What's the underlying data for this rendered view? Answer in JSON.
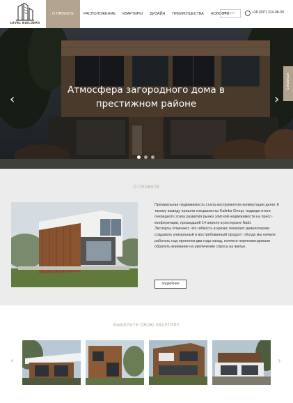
{
  "header": {
    "logo_text": "LEVEL BUILDERS",
    "nav": [
      {
        "label": "О ПРОЕКТЕ",
        "active": true
      },
      {
        "label": "РАСПОЛОЖЕНИЕ"
      },
      {
        "label": "КВАРТИРЫ"
      },
      {
        "label": "ДИЗАЙН"
      },
      {
        "label": "ПРЕИМУЩЕСТВА"
      },
      {
        "label": "НОВОСТИ"
      }
    ],
    "lang_current": "en",
    "lang_alt": "| рус",
    "phone": "+38 (097) 324-98-09"
  },
  "hero": {
    "title": "Атмосфера загородного дома в престижном районе",
    "slides_count": 3,
    "active_slide": 1,
    "side_tab_label": "Связаться"
  },
  "about": {
    "title": "О ПРОЕКТЕ",
    "paragraph1": "Премиальная недвижимость стала инструментом конвертации денег. К такому выводу пришли специалисты Kalinka Group, подводя итоги очередного этапа развития рынка элитной недвижимости на пресс-конференции, прошедшей 14 апреля в ресторане Nabi.",
    "paragraph2": "Эксперты отмечают, что гибкость в кризис помогает девелоперам создавать уникальный и востребованный продукт: «Когда мы начали работать над проектом два года назад, коллеги порекомендовали обратить внимание на увеличение спроса на жилье.",
    "button_label": "подробнее"
  },
  "apartments": {
    "title": "ВЫБЕРИТЕ СВОЮ КВАРТИРУ",
    "prev_arrow": "‹",
    "next_arrow": "›"
  },
  "arrows": {
    "left": "‹",
    "right": "›"
  },
  "colors": {
    "accent": "#b3a48f",
    "section_bg": "#ececec",
    "hero_overlay": "#2a2a2a"
  }
}
